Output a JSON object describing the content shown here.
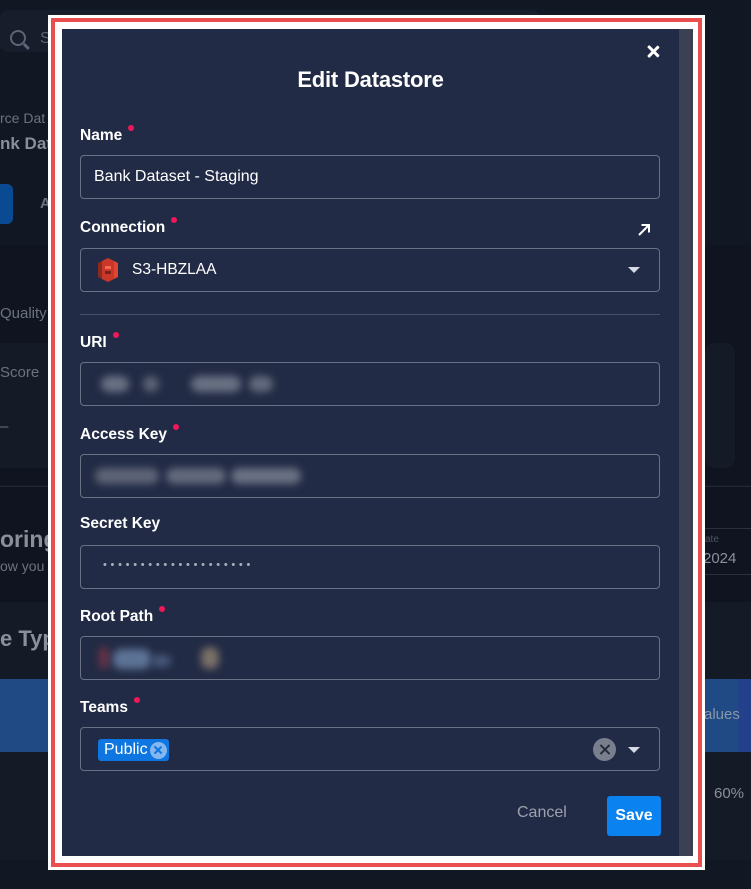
{
  "background": {
    "search_placeholder": "S",
    "breadcrumb": "rce Dat",
    "title": "nk Dat",
    "tab": "A",
    "quality_label": "Quality",
    "score_label": "Score",
    "score_value": "–",
    "monitoring_title": "oring",
    "monitoring_sub": "ow you",
    "date_label": "ate",
    "date_value": "2024",
    "types_title": "e Type",
    "bar_label": "alues",
    "percent": "60%"
  },
  "modal": {
    "title": "Edit Datastore",
    "fields": {
      "name": {
        "label": "Name",
        "required": true,
        "value": "Bank Dataset - Staging"
      },
      "connection": {
        "label": "Connection",
        "required": true,
        "value": "S3-HBZLAA",
        "icon": "aws-s3-icon"
      },
      "uri": {
        "label": "URI",
        "required": true,
        "value": "[redacted]"
      },
      "access_key": {
        "label": "Access Key",
        "required": true,
        "value": "[redacted]"
      },
      "secret_key": {
        "label": "Secret Key",
        "required": false,
        "value": "••••••••••••••••••••"
      },
      "root_path": {
        "label": "Root Path",
        "required": true,
        "value": "[redacted]"
      },
      "teams": {
        "label": "Teams",
        "required": true,
        "selected": [
          "Public"
        ]
      }
    },
    "buttons": {
      "cancel": "Cancel",
      "save": "Save"
    }
  },
  "colors": {
    "modal_bg": "#222b45",
    "required_dot": "#f0185a",
    "primary": "#0a82f0",
    "chip": "#0d76e0",
    "highlight_frame": "#ea4f4f"
  }
}
